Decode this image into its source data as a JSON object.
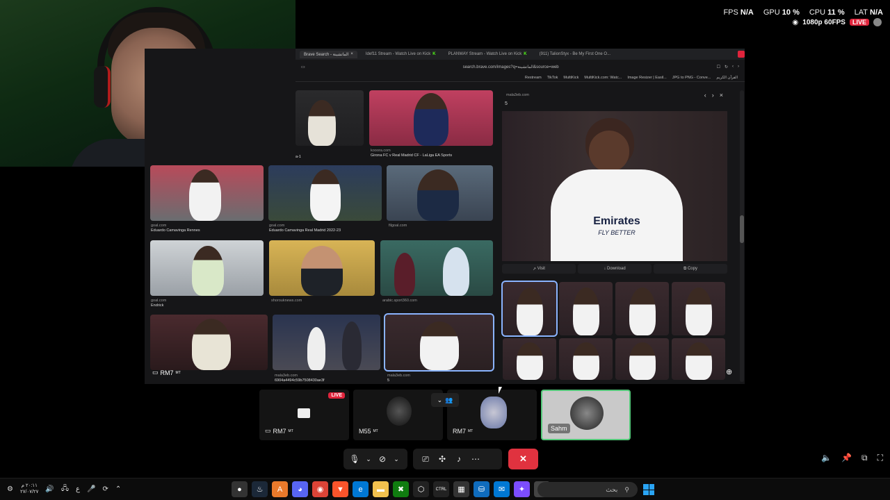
{
  "overlay": {
    "fps_label": "FPS",
    "fps_value": "N/A",
    "gpu_label": "GPU",
    "gpu_value": "10 %",
    "cpu_label": "CPU",
    "cpu_value": "11 %",
    "lat_label": "LAT",
    "lat_value": "N/A",
    "quality": "1080p 60FPS",
    "live": "LIVE"
  },
  "browser": {
    "tabs": [
      {
        "label": "Brave Search - الماتشينة",
        "active": true
      },
      {
        "label": "Idef11 Stream - Watch Live on Kick",
        "active": false
      },
      {
        "label": "PLANWAY Stream - Watch Live on Kick",
        "active": false
      },
      {
        "label": "(911) TalionStyx - Be My First One O...",
        "active": false
      }
    ],
    "url": "search.brave.com/images?q=الماتشينة&source=web",
    "bookmarks": [
      "Restream",
      "TikTok",
      "MultiKick",
      "MultiKick.com: Watc...",
      "Image Resizer | Easil...",
      "JPG to PNG - Conve...",
      "القرآن الكريم"
    ],
    "grid": [
      {
        "source": "",
        "title": "a-1"
      },
      {
        "source": "kooora.com",
        "title": "Girona FC v Real Madrid CF - LaLiga EA Sports"
      },
      {
        "source": "goal.com",
        "title": "Eduardo Camavinga Rennes"
      },
      {
        "source": "goal.com",
        "title": "Eduardo Camavinga Real Madrid 2022-23"
      },
      {
        "source": "filgoal.com",
        "title": ""
      },
      {
        "source": "goal.com",
        "title": "Endrick"
      },
      {
        "source": "shorouknews.com",
        "title": ""
      },
      {
        "source": "arabic.sport360.com",
        "title": ""
      },
      {
        "source": "",
        "title": ""
      },
      {
        "source": "mala3eb.com",
        "title": "6904a4494c59b7508430ae3f"
      },
      {
        "source": "mala3eb.com",
        "title": "5"
      }
    ],
    "preview": {
      "source": "mala3eb.com",
      "number": "5",
      "visit": "Visit",
      "download": "Download",
      "copy": "Copy",
      "shirt_line1": "Emirates",
      "shirt_line2": "FLY BETTER"
    }
  },
  "tiles": [
    {
      "name": "RM7",
      "suffix": "MT",
      "live": "LIVE"
    },
    {
      "name": "M55",
      "suffix": "MT"
    },
    {
      "name": "RM7",
      "suffix": "MT"
    },
    {
      "name": "Sahm",
      "suffix": ""
    }
  ],
  "taskbar": {
    "time": "٢٠:١١ م",
    "date": "٢٧/٠٧/٢٧",
    "lang": "ع",
    "search_placeholder": "بحث",
    "ctrl_label": "CTRL"
  },
  "colors": {
    "accent_live": "#e0243c",
    "kick_green": "#53fc18",
    "select_blue": "#8ab4ff",
    "hangup_red": "#e0323f",
    "active_tile_border": "#55c87a"
  }
}
